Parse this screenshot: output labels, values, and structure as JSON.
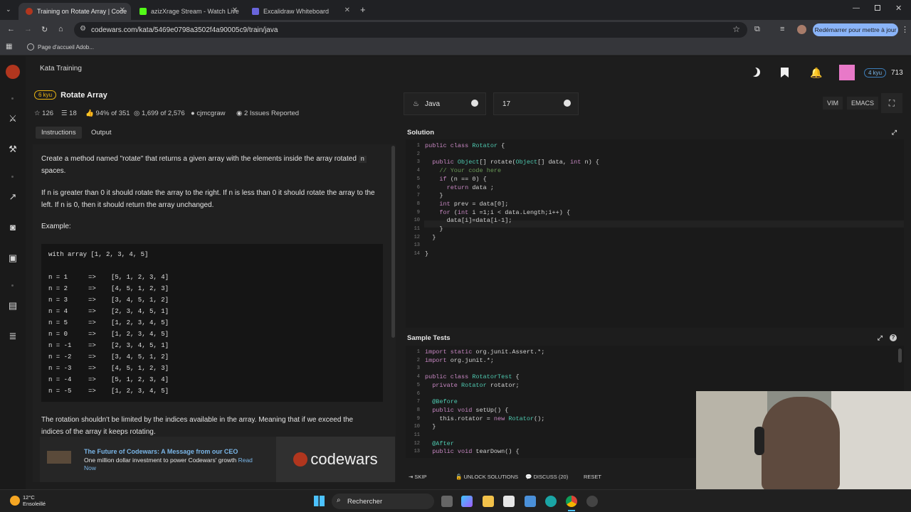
{
  "browser": {
    "tabs": [
      {
        "title": "Training on Rotate Array | Code",
        "color": "#b1361e",
        "active": true
      },
      {
        "title": "azizXrage Stream - Watch Live",
        "color": "#53fc18",
        "active": false
      },
      {
        "title": "Excalidraw Whiteboard",
        "color": "#6965db",
        "active": false
      }
    ],
    "url": "codewars.com/kata/5469e0798a3502f4a90005c9/train/java",
    "restart_label": "Redémarrer pour mettre à jour",
    "bookmark": "Page d'accueil Adob..."
  },
  "header": {
    "breadcrumb": "Kata Training",
    "kyu_badge": "4 kyu",
    "honor": "713"
  },
  "kata": {
    "rank": "6 kyu",
    "title": "Rotate Array",
    "stars": "126",
    "collections": "18",
    "satisfaction": "94% of 351",
    "completed": "1,699 of 2,576",
    "author": "cjmcgraw",
    "issues": "2 Issues Reported"
  },
  "desc_tabs": {
    "instructions": "Instructions",
    "output": "Output"
  },
  "description": {
    "p1a": "Create a method named \"rotate\" that returns a given array with the elements inside the array rotated",
    "p1_code": "n",
    "p1b": "spaces.",
    "p2": "If n is greater than 0 it should rotate the array to the right. If n is less than 0 it should rotate the array to the left. If n is 0, then it should return the array unchanged.",
    "example_label": "Example:",
    "code_header": "with array [1, 2, 3, 4, 5]",
    "code_rows": [
      [
        "n = 1",
        "=>",
        "[5, 1, 2, 3, 4]"
      ],
      [
        "n = 2",
        "=>",
        "[4, 5, 1, 2, 3]"
      ],
      [
        "n = 3",
        "=>",
        "[3, 4, 5, 1, 2]"
      ],
      [
        "n = 4",
        "=>",
        "[2, 3, 4, 5, 1]"
      ],
      [
        "n = 5",
        "=>",
        "[1, 2, 3, 4, 5]"
      ],
      [
        "n = 0",
        "=>",
        "[1, 2, 3, 4, 5]"
      ],
      [
        "n = -1",
        "=>",
        "[2, 3, 4, 5, 1]"
      ],
      [
        "n = -2",
        "=>",
        "[3, 4, 5, 1, 2]"
      ],
      [
        "n = -3",
        "=>",
        "[4, 5, 1, 2, 3]"
      ],
      [
        "n = -4",
        "=>",
        "[5, 1, 2, 3, 4]"
      ],
      [
        "n = -5",
        "=>",
        "[1, 2, 3, 4, 5]"
      ]
    ],
    "p3": "The rotation shouldn't be limited by the indices available in the array. Meaning that if we exceed the indices of the array it keeps rotating."
  },
  "promo": {
    "title": "The Future of Codewars: A Message from our CEO",
    "body": "One million dollar investment to power Codewars' growth",
    "link": "Read Now",
    "logo_text": "codewars"
  },
  "editor": {
    "language": "Java",
    "version": "17",
    "vim": "VIM",
    "emacs": "EMACS",
    "solution_label": "Solution",
    "solution_lines": [
      "public class Rotator {",
      "",
      "  public Object[] rotate(Object[] data, int n) {",
      "    // Your code here",
      "    if (n == 0) {",
      "      return data ;",
      "    }",
      "    int prev = data[0];",
      "    for (int i =1;i < data.Length;i++) {",
      "      data[i]=data[i-1];",
      "    }",
      "  }",
      "",
      "}"
    ],
    "tests_label": "Sample Tests",
    "test_lines": [
      "import static org.junit.Assert.*;",
      "import org.junit.*;",
      "",
      "public class RotatorTest {",
      "  private Rotator rotator;",
      "",
      "  @Before",
      "  public void setUp() {",
      "    this.rotator = new Rotator();",
      "  }",
      "",
      "  @After",
      "  public void tearDown() {"
    ]
  },
  "footer": {
    "skip": "SKIP",
    "unlock": "UNLOCK SOLUTIONS",
    "discuss": "DISCUSS (20)",
    "reset": "RESET"
  },
  "taskbar": {
    "weather_temp": "12°C",
    "weather_desc": "Ensoleillé",
    "search": "Rechercher"
  }
}
